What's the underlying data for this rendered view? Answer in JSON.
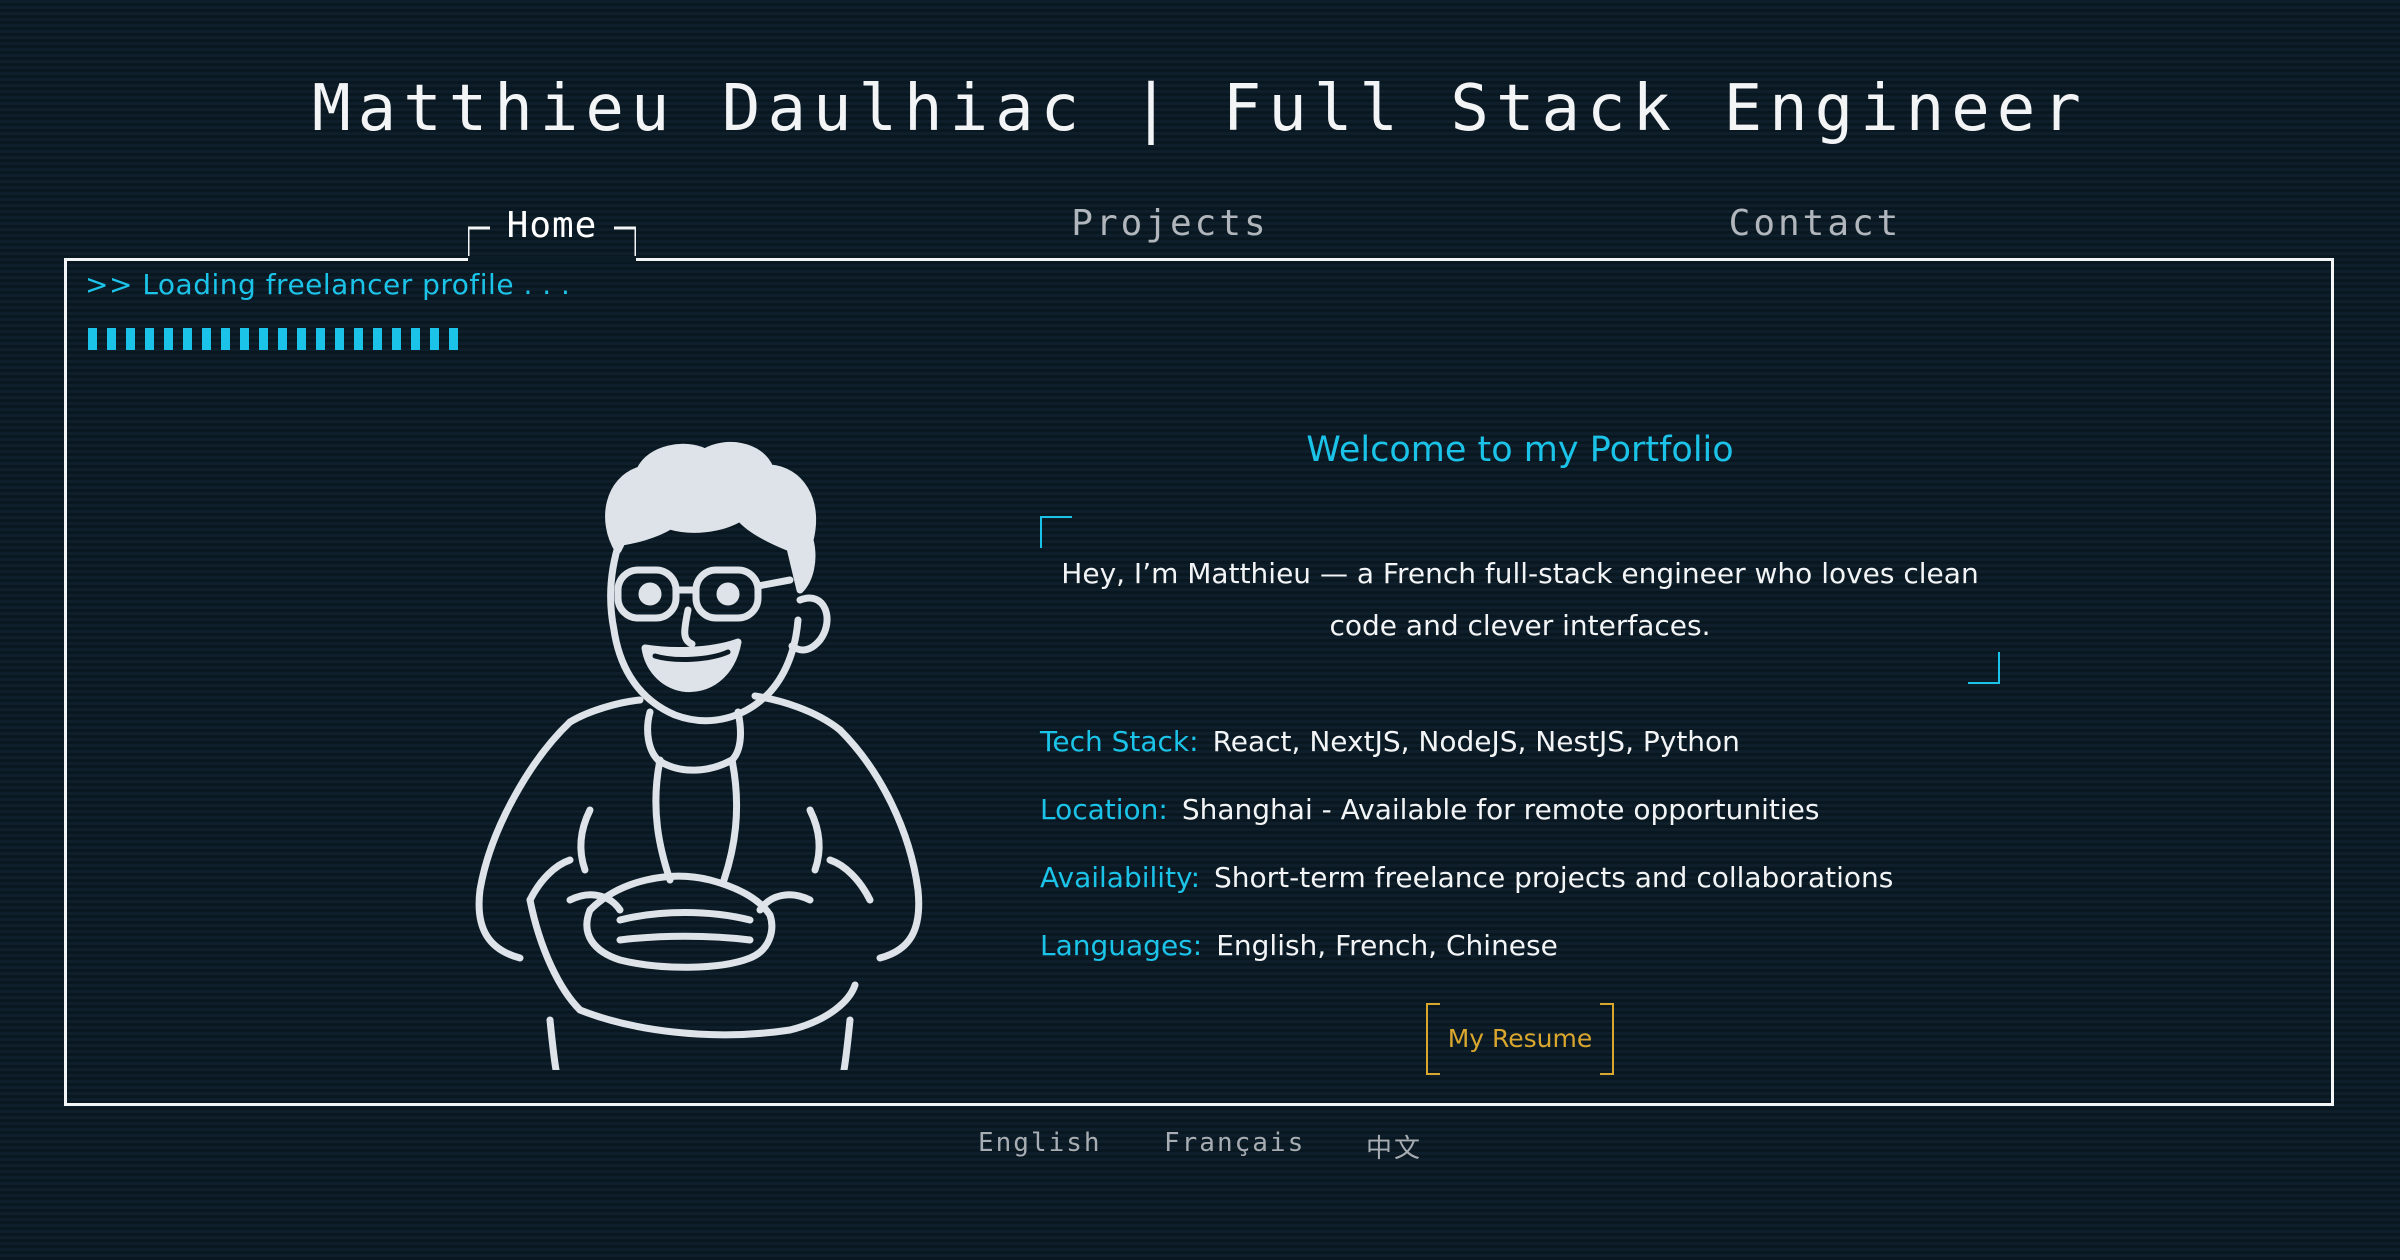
{
  "header": {
    "title": "Matthieu Daulhiac | Full Stack Engineer"
  },
  "nav": {
    "home": "Home",
    "projects": "Projects",
    "contact": "Contact",
    "active": "Home"
  },
  "loader": {
    "text": ">> Loading freelancer profile . . .",
    "segments": 20
  },
  "main": {
    "welcome": "Welcome to my Portfolio",
    "intro": "Hey, I’m Matthieu — a French full-stack engineer who loves clean code and clever interfaces.",
    "info": [
      {
        "label": "Tech Stack:",
        "value": "React, NextJS, NodeJS, NestJS, Python"
      },
      {
        "label": "Location:",
        "value": "Shanghai - Available for remote opportunities"
      },
      {
        "label": "Availability:",
        "value": "Short-term freelance projects and collaborations"
      },
      {
        "label": "Languages:",
        "value": "English, French, Chinese"
      }
    ],
    "resume_button": "My Resume"
  },
  "footer": {
    "languages": [
      "English",
      "Français",
      "中文"
    ]
  },
  "colors": {
    "background": "#0b1a24",
    "accent": "#1cc3e8",
    "text": "#f2f4f6",
    "button": "#d9a62e",
    "muted": "#a7adb2"
  },
  "icons": {
    "avatar": "cartoon-developer-avatar"
  }
}
